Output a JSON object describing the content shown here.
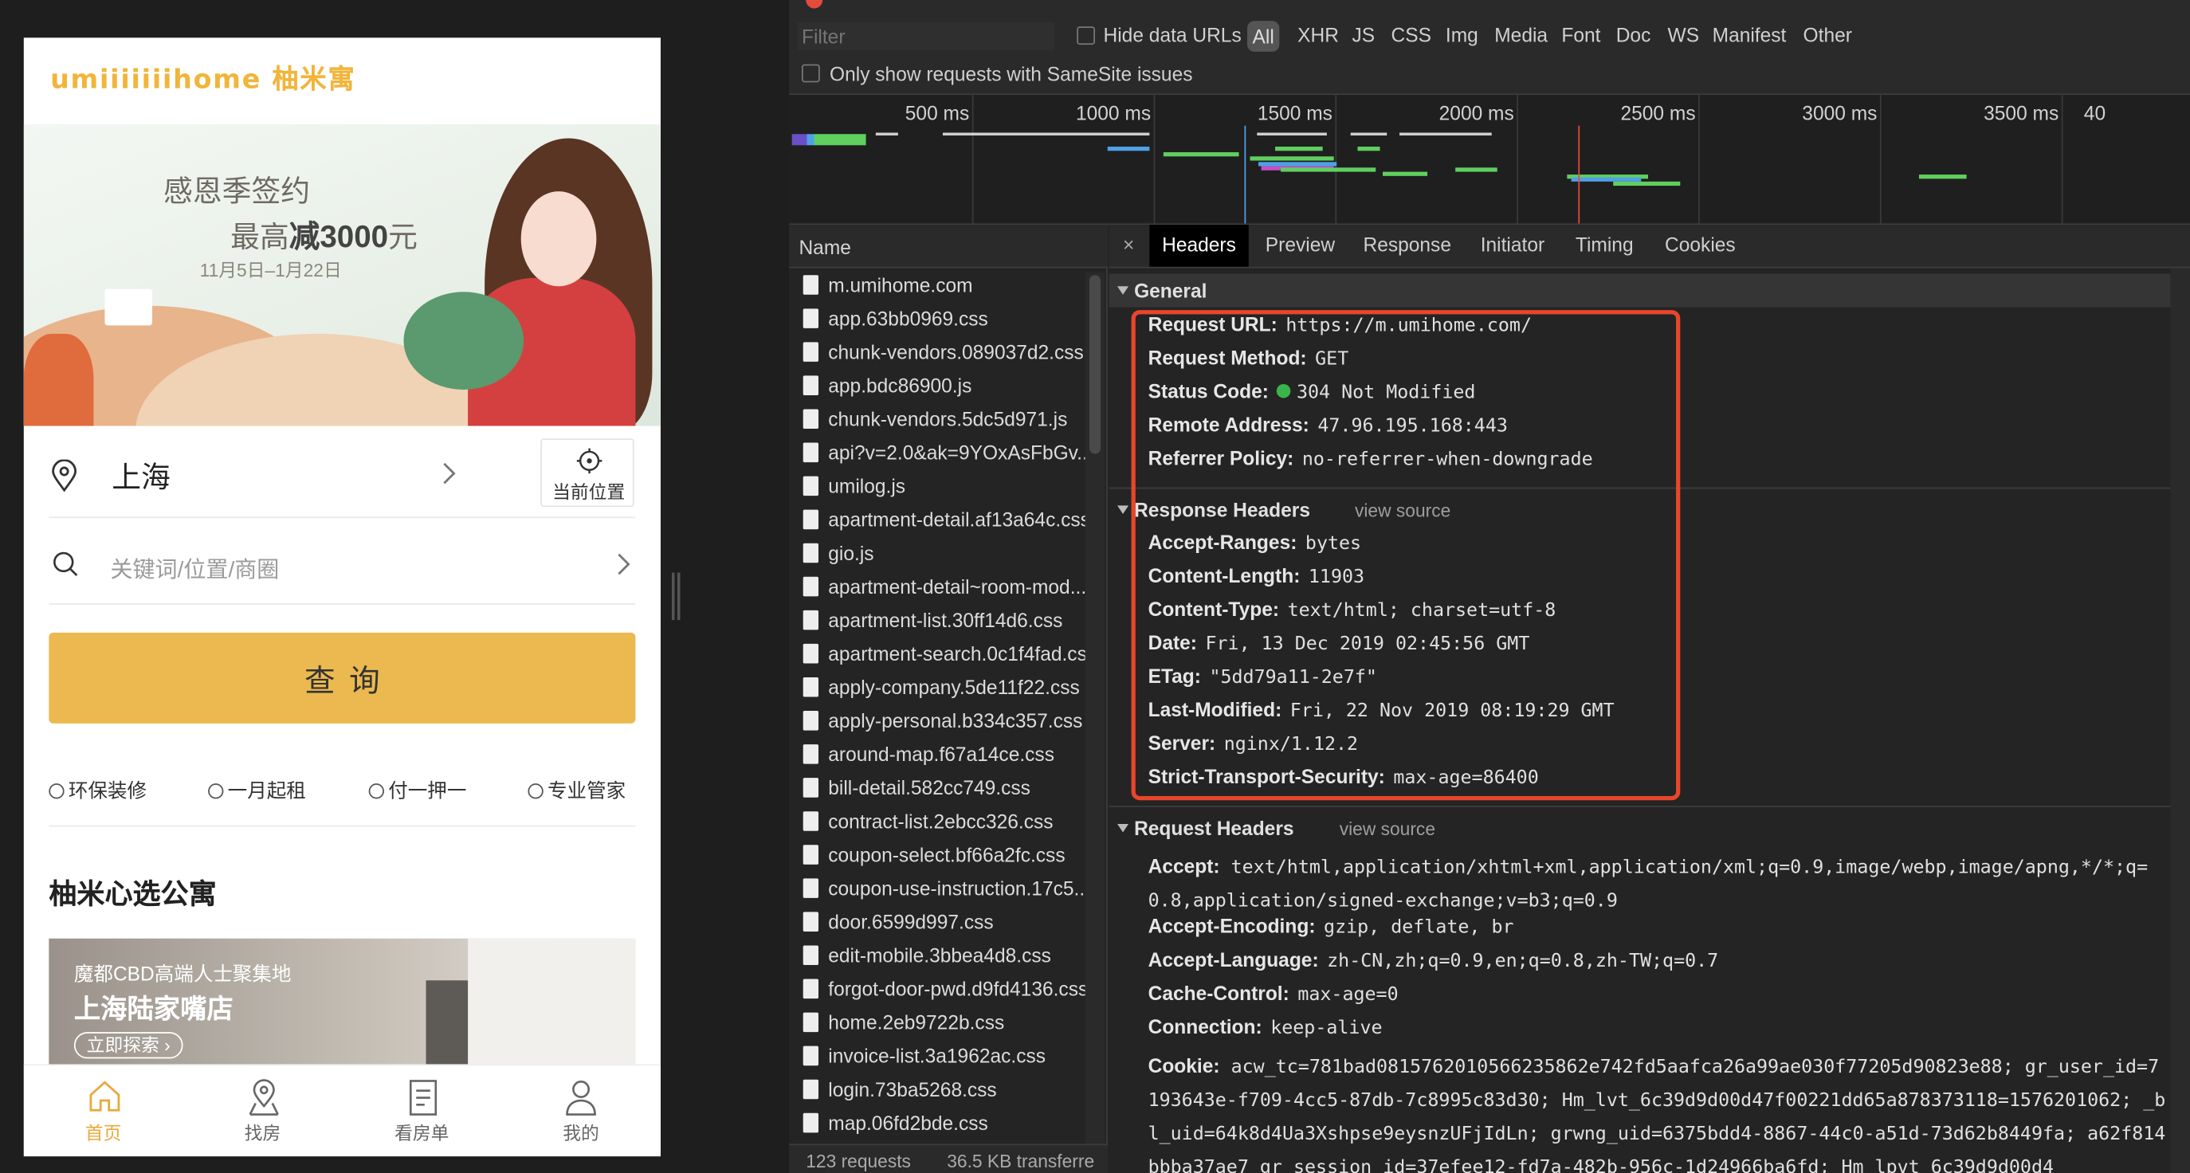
{
  "phone": {
    "logo": "umiiiiiiihome 柚米寓",
    "banner": {
      "line1": "感恩季签约",
      "line2_pre": "最高",
      "line2_bold": "减3000",
      "line2_post": "元",
      "dates": "11月5日–1月22日"
    },
    "city": "上海",
    "locate_label": "当前位置",
    "search_placeholder": "关键词/位置/商圈",
    "query_button": "查询",
    "features": [
      "环保装修",
      "一月起租",
      "付一押一",
      "专业管家"
    ],
    "section_title": "柚米心选公寓",
    "card": {
      "subtitle": "魔都CBD高端人士聚集地",
      "title": "上海陆家嘴店",
      "cta": "立即探索 ›"
    },
    "tabs": [
      {
        "label": "首页",
        "icon": "home-icon"
      },
      {
        "label": "找房",
        "icon": "map-pin-icon"
      },
      {
        "label": "看房单",
        "icon": "list-icon"
      },
      {
        "label": "我的",
        "icon": "user-icon"
      }
    ]
  },
  "devtools": {
    "filter_placeholder": "Filter",
    "hide_data_urls": "Hide data URLs",
    "type_filters": [
      "All",
      "XHR",
      "JS",
      "CSS",
      "Img",
      "Media",
      "Font",
      "Doc",
      "WS",
      "Manifest",
      "Other"
    ],
    "samesite_label": "Only show requests with SameSite issues",
    "timeline_ticks": [
      "500 ms",
      "1000 ms",
      "1500 ms",
      "2000 ms",
      "2500 ms",
      "3000 ms",
      "3500 ms",
      "40"
    ],
    "name_header": "Name",
    "requests": [
      "m.umihome.com",
      "app.63bb0969.css",
      "chunk-vendors.089037d2.css",
      "app.bdc86900.js",
      "chunk-vendors.5dc5d971.js",
      "api?v=2.0&ak=9YOxAsFbGv...",
      "umilog.js",
      "apartment-detail.af13a64c.css",
      "gio.js",
      "apartment-detail~room-mod...",
      "apartment-list.30ff14d6.css",
      "apartment-search.0c1f4fad.css",
      "apply-company.5de11f22.css",
      "apply-personal.b334c357.css",
      "around-map.f67a14ce.css",
      "bill-detail.582cc749.css",
      "contract-list.2ebcc326.css",
      "coupon-select.bf66a2fc.css",
      "coupon-use-instruction.17c5...",
      "door.6599d997.css",
      "edit-mobile.3bbea4d8.css",
      "forgot-door-pwd.d9fd4136.css",
      "home.2eb9722b.css",
      "invoice-list.3a1962ac.css",
      "login.73ba5268.css",
      "map.06fd2bde.css"
    ],
    "status_requests": "123 requests",
    "status_transferred": "36.5 KB transferre",
    "detail_tabs": [
      "Headers",
      "Preview",
      "Response",
      "Initiator",
      "Timing",
      "Cookies"
    ],
    "general_title": "General",
    "general": [
      {
        "k": "Request URL:",
        "v": "https://m.umihome.com/"
      },
      {
        "k": "Request Method:",
        "v": "GET"
      },
      {
        "k": "Status Code:",
        "v": "304 Not Modified"
      },
      {
        "k": "Remote Address:",
        "v": "47.96.195.168:443"
      },
      {
        "k": "Referrer Policy:",
        "v": "no-referrer-when-downgrade"
      }
    ],
    "response_title": "Response Headers",
    "view_source": "view source",
    "response": [
      {
        "k": "Accept-Ranges:",
        "v": "bytes"
      },
      {
        "k": "Content-Length:",
        "v": "11903"
      },
      {
        "k": "Content-Type:",
        "v": "text/html; charset=utf-8"
      },
      {
        "k": "Date:",
        "v": "Fri, 13 Dec 2019 02:45:56 GMT"
      },
      {
        "k": "ETag:",
        "v": "\"5dd79a11-2e7f\""
      },
      {
        "k": "Last-Modified:",
        "v": "Fri, 22 Nov 2019 08:19:29 GMT"
      },
      {
        "k": "Server:",
        "v": "nginx/1.12.2"
      },
      {
        "k": "Strict-Transport-Security:",
        "v": "max-age=86400"
      }
    ],
    "request_title": "Request Headers",
    "accept_k": "Accept:",
    "accept_v": "text/html,application/xhtml+xml,application/xml;q=0.9,image/webp,image/apng,*/*;q=0.8,application/signed-exchange;v=b3;q=0.9",
    "request": [
      {
        "k": "Accept-Encoding:",
        "v": "gzip, deflate, br"
      },
      {
        "k": "Accept-Language:",
        "v": "zh-CN,zh;q=0.9,en;q=0.8,zh-TW;q=0.7"
      },
      {
        "k": "Cache-Control:",
        "v": "max-age=0"
      },
      {
        "k": "Connection:",
        "v": "keep-alive"
      }
    ],
    "cookie_k": "Cookie:",
    "cookie_v": "acw_tc=781bad0815762010566235862e742fd5aafca26a99ae030f77205d90823e88; gr_user_id=7193643e-f709-4cc5-87db-7c8995c83d30; Hm_lvt_6c39d9d00d47f00221dd65a878373118=1576201062; _bl_uid=64k8d4Ua3Xshpse9eysnzUFjIdLn; grwng_uid=6375bdd4-8867-44c0-a51d-73d62b8449fa; a62f814bbba37ae7_gr_session_id=37efee12-fd7a-482b-956c-1d24966ba6fd; Hm_lpvt_6c39d9d00d4",
    "status_color": "#3bb54a",
    "highlight_color": "#e8462c"
  }
}
